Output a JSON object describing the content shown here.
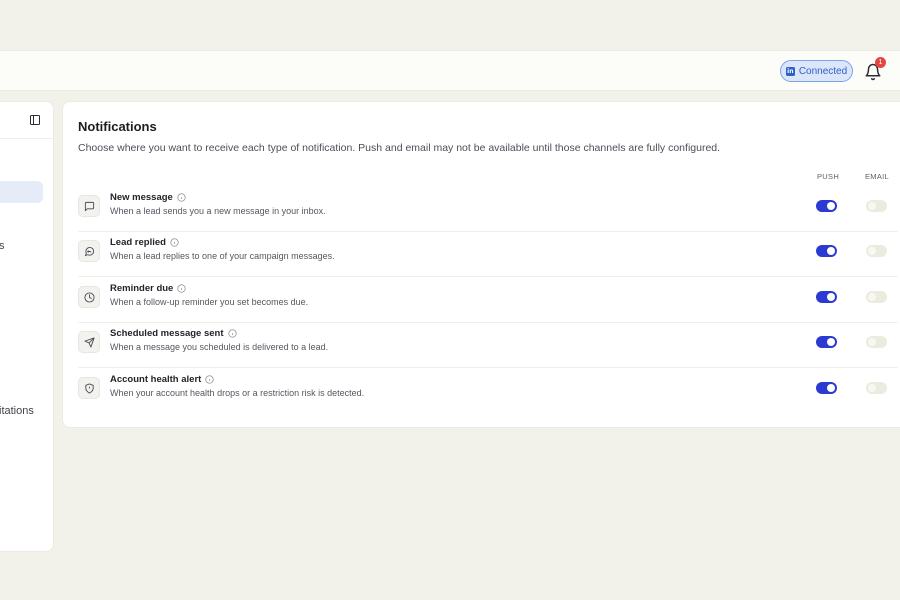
{
  "header": {
    "connected_label": "Connected",
    "linkedin_glyph": "in",
    "notification_count": "1"
  },
  "sidebar": {
    "partial_item_1": "s",
    "partial_item_2": "itations"
  },
  "notifications": {
    "title": "Notifications",
    "description": "Choose where you want to receive each type of notification. Push and email may not be available until those channels are fully configured.",
    "columns": {
      "push": "PUSH",
      "email": "EMAIL"
    },
    "items": [
      {
        "title": "New message",
        "subtitle": "When a lead sends you a new message in your inbox.",
        "icon": "message-square-icon",
        "push": true,
        "email": false
      },
      {
        "title": "Lead replied",
        "subtitle": "When a lead replies to one of your campaign messages.",
        "icon": "reply-bubble-icon",
        "push": true,
        "email": false
      },
      {
        "title": "Reminder due",
        "subtitle": "When a follow-up reminder you set becomes due.",
        "icon": "clock-icon",
        "push": true,
        "email": false
      },
      {
        "title": "Scheduled message sent",
        "subtitle": "When a message you scheduled is delivered to a lead.",
        "icon": "send-icon",
        "push": true,
        "email": false
      },
      {
        "title": "Account health alert",
        "subtitle": "When your account health drops or a restriction risk is detected.",
        "icon": "shield-icon",
        "push": true,
        "email": false
      }
    ]
  },
  "colors": {
    "toggle_on": "#2b3ad0",
    "toggle_off": "#ecebdf",
    "badge": "#e2473f",
    "connected_bg": "#dbe6fb"
  }
}
